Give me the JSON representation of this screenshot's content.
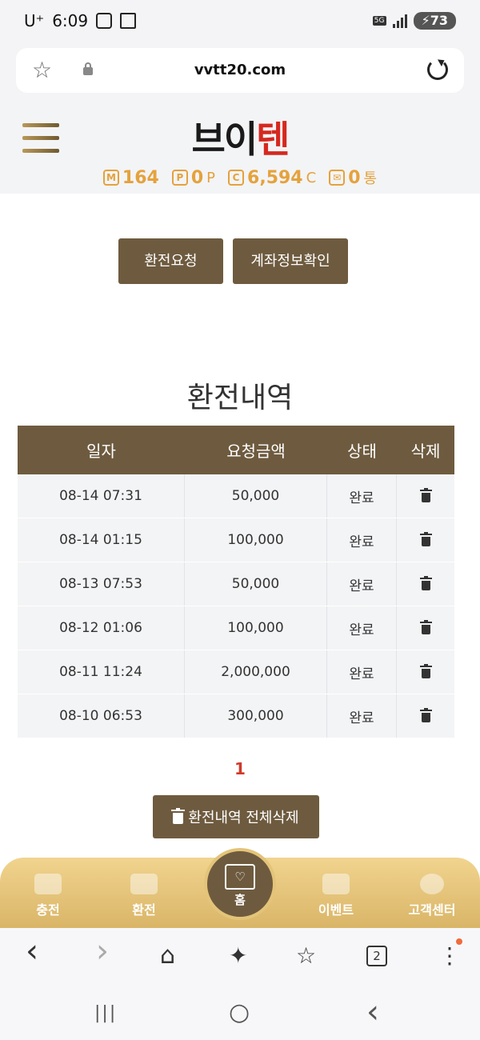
{
  "status": {
    "carrier": "U⁺",
    "time": "6:09",
    "network": "5G",
    "battery": "73"
  },
  "browser": {
    "url": "vvtt20.com",
    "tab_count": "2"
  },
  "site": {
    "logo_main": "브이",
    "logo_accent": "텐",
    "points": [
      {
        "icon": "M",
        "value": "164",
        "unit": ""
      },
      {
        "icon": "P",
        "value": "0",
        "unit": "P"
      },
      {
        "icon": "C",
        "value": "6,594",
        "unit": "C"
      },
      {
        "icon": "✉",
        "value": "0",
        "unit": "통"
      }
    ]
  },
  "actions": {
    "withdraw_request": "환전요청",
    "account_check": "계좌정보확인"
  },
  "history": {
    "title": "환전내역",
    "headers": [
      "일자",
      "요청금액",
      "상태",
      "삭제"
    ],
    "rows": [
      {
        "date": "08-14 07:31",
        "amount": "50,000",
        "status": "완료"
      },
      {
        "date": "08-14 01:15",
        "amount": "100,000",
        "status": "완료"
      },
      {
        "date": "08-13 07:53",
        "amount": "50,000",
        "status": "완료"
      },
      {
        "date": "08-12 01:06",
        "amount": "100,000",
        "status": "완료"
      },
      {
        "date": "08-11 11:24",
        "amount": "2,000,000",
        "status": "완료"
      },
      {
        "date": "08-10 06:53",
        "amount": "300,000",
        "status": "완료"
      }
    ],
    "page": "1",
    "delete_all": "환전내역 전체삭제"
  },
  "bottom_nav": {
    "charge": "충전",
    "withdraw": "환전",
    "home": "홈",
    "event": "이벤트",
    "support": "고객센터",
    "home_symbol": "♡"
  },
  "toolbar": {
    "back": "‹",
    "forward": "›",
    "home": "⌂",
    "assistant": "✦",
    "bookmarks": "☆",
    "more": "⋮"
  },
  "system_nav": {
    "recents": "|||",
    "home": "○",
    "back": "‹"
  },
  "colors": {
    "brand_brown": "#6e5b3f",
    "gold": "#e5a23c",
    "logo_red": "#d6281f",
    "page_red": "#d03a2a"
  }
}
